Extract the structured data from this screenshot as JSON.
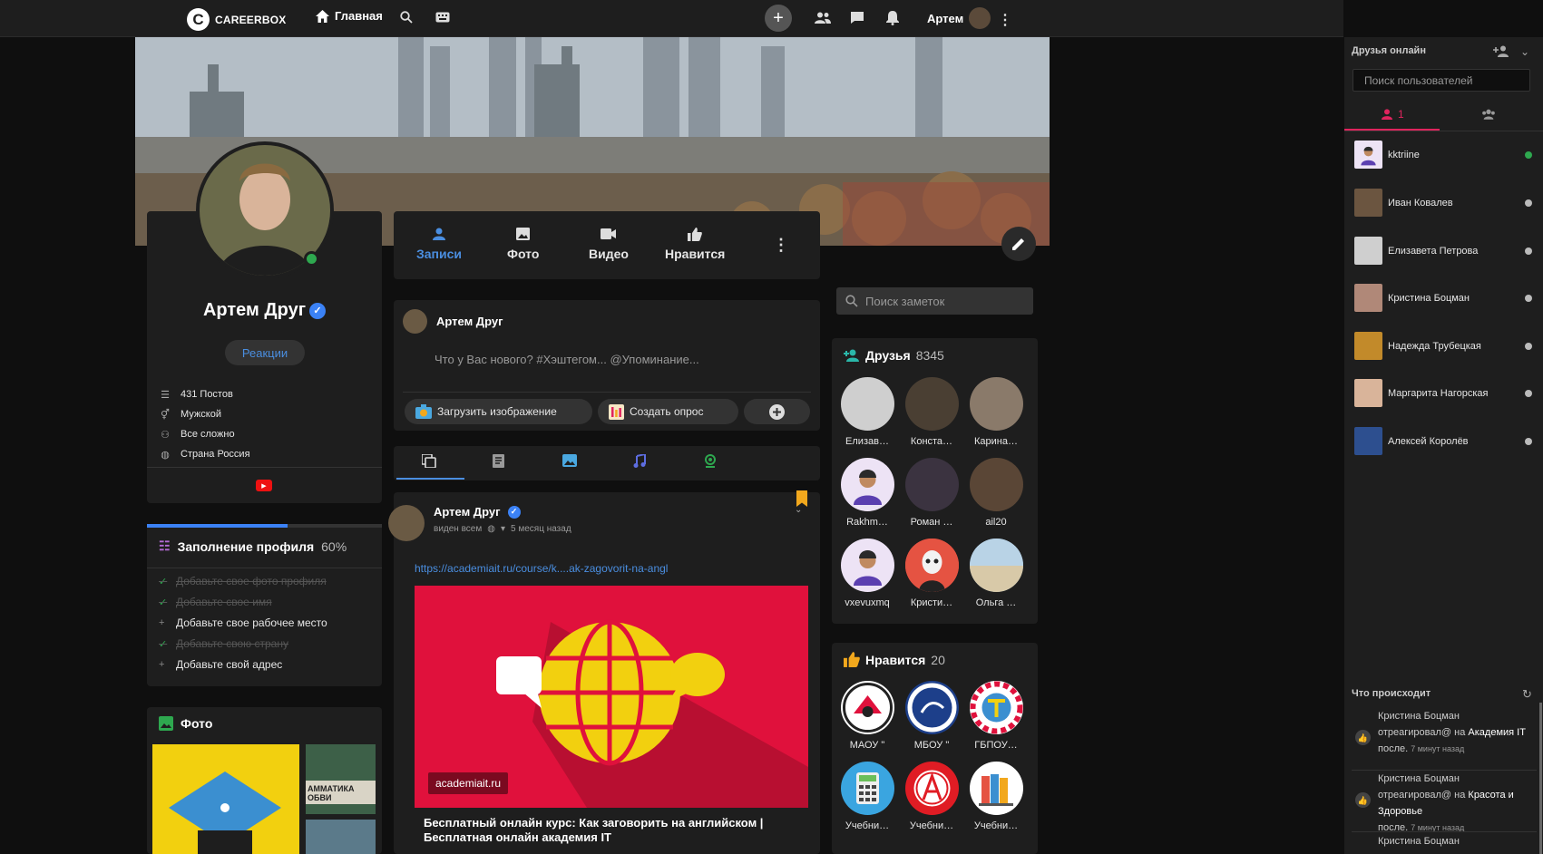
{
  "topbar": {
    "logo_text": "CAREERBOX",
    "home_label": "Главная",
    "user_name": "Артем"
  },
  "profile": {
    "name": "Артем Друг",
    "reactions_label": "Реакции",
    "info": [
      {
        "icon": "list-icon",
        "text": "431 Постов"
      },
      {
        "icon": "gender-icon",
        "text": "Мужской"
      },
      {
        "icon": "relationship-icon",
        "text": "Все сложно"
      },
      {
        "icon": "globe-icon",
        "text": "Страна Россия"
      }
    ]
  },
  "completion": {
    "title": "Заполнение профиля",
    "percent_label": "60%",
    "percent": 60,
    "items": [
      {
        "text": "Добавьте свое фото профиля",
        "done": true
      },
      {
        "text": "Добавьте свое имя",
        "done": true
      },
      {
        "text": "Добавьте свое рабочее место",
        "done": false
      },
      {
        "text": "Добавьте свою страну",
        "done": true
      },
      {
        "text": "Добавьте свой адрес",
        "done": false
      }
    ]
  },
  "photos": {
    "title": "Фото",
    "thumb_text": "АММАТИКА ОБВИ"
  },
  "tabs": [
    {
      "label": "Записи",
      "icon": "person-icon",
      "active": true
    },
    {
      "label": "Фото",
      "icon": "image-icon",
      "active": false
    },
    {
      "label": "Видео",
      "icon": "video-icon",
      "active": false
    },
    {
      "label": "Нравится",
      "icon": "thumbs-up-icon",
      "active": false
    }
  ],
  "composer": {
    "user": "Артем Друг",
    "placeholder": "Что у Вас нового? #Хэштегом... @Упоминание...",
    "upload_label": "Загрузить изображение",
    "poll_label": "Создать опрос"
  },
  "post": {
    "author": "Артем Друг",
    "visibility": "виден всем",
    "time": "5 месяц назад",
    "link": "https://academiait.ru/course/k....ak-zagovorit-na-angl",
    "site": "academiait.ru",
    "caption": "Бесплатный онлайн курс: Как заговорить на английском | Бесплатная онлайн академия IT"
  },
  "notes_search": {
    "placeholder": "Поиск заметок"
  },
  "friends": {
    "title": "Друзья",
    "count": "8345",
    "items": [
      {
        "name": "Елизав…",
        "color": "#cfcfcf"
      },
      {
        "name": "Конста…",
        "color": "#4a3f33"
      },
      {
        "name": "Карина…",
        "color": "#8a7a6a"
      },
      {
        "name": "Rakhm…",
        "color": "#ede3f5"
      },
      {
        "name": "Роман …",
        "color": "#3b3340"
      },
      {
        "name": "ail20",
        "color": "#5a4636"
      },
      {
        "name": "vxevuxmq",
        "color": "#ede3f5"
      },
      {
        "name": "Кристи…",
        "color": "#e55342"
      },
      {
        "name": "Ольга …",
        "color": "#7fa6c4"
      }
    ]
  },
  "likes": {
    "title": "Нравится",
    "count": "20",
    "items": [
      {
        "name": "МАОУ \"",
        "color": "#ffffff"
      },
      {
        "name": "МБОУ \"",
        "color": "#1d3f8a"
      },
      {
        "name": "ГБПОУ…",
        "color": "#ffffff"
      },
      {
        "name": "Учебни…",
        "color": "#3aa5e0"
      },
      {
        "name": "Учебни…",
        "color": "#e01c24"
      },
      {
        "name": "Учебни…",
        "color": "#ffffff"
      }
    ]
  },
  "sidebar": {
    "title": "Друзья онлайн",
    "search_placeholder": "Поиск пользователей",
    "online_count": "1",
    "users": [
      {
        "name": "kktriine",
        "online": true,
        "color": "#ede3f5"
      },
      {
        "name": "Иван Ковалев",
        "online": false,
        "color": "#6b5540"
      },
      {
        "name": "Елизавета Петрова",
        "online": false,
        "color": "#cfcfcf"
      },
      {
        "name": "Кристина Боцман",
        "online": false,
        "color": "#b08878"
      },
      {
        "name": "Надежда Трубецкая",
        "online": false,
        "color": "#c28a2a"
      },
      {
        "name": "Маргарита Нагорская",
        "online": false,
        "color": "#d9b49a"
      },
      {
        "name": "Алексей Королёв",
        "online": false,
        "color": "#2d4f8f"
      }
    ],
    "happening_title": "Что происходит",
    "activity": [
      {
        "user": "Кристина Боцман",
        "action": "отреагировал@ на",
        "target": "Академия IT",
        "suffix": "после.",
        "time": "7 минут назад"
      },
      {
        "user": "Кристина Боцман",
        "action": "отреагировал@ на",
        "target": "Красота и Здоровье",
        "suffix": "после.",
        "time": "7 минут назад"
      },
      {
        "user": "Кристина Боцман"
      }
    ]
  }
}
